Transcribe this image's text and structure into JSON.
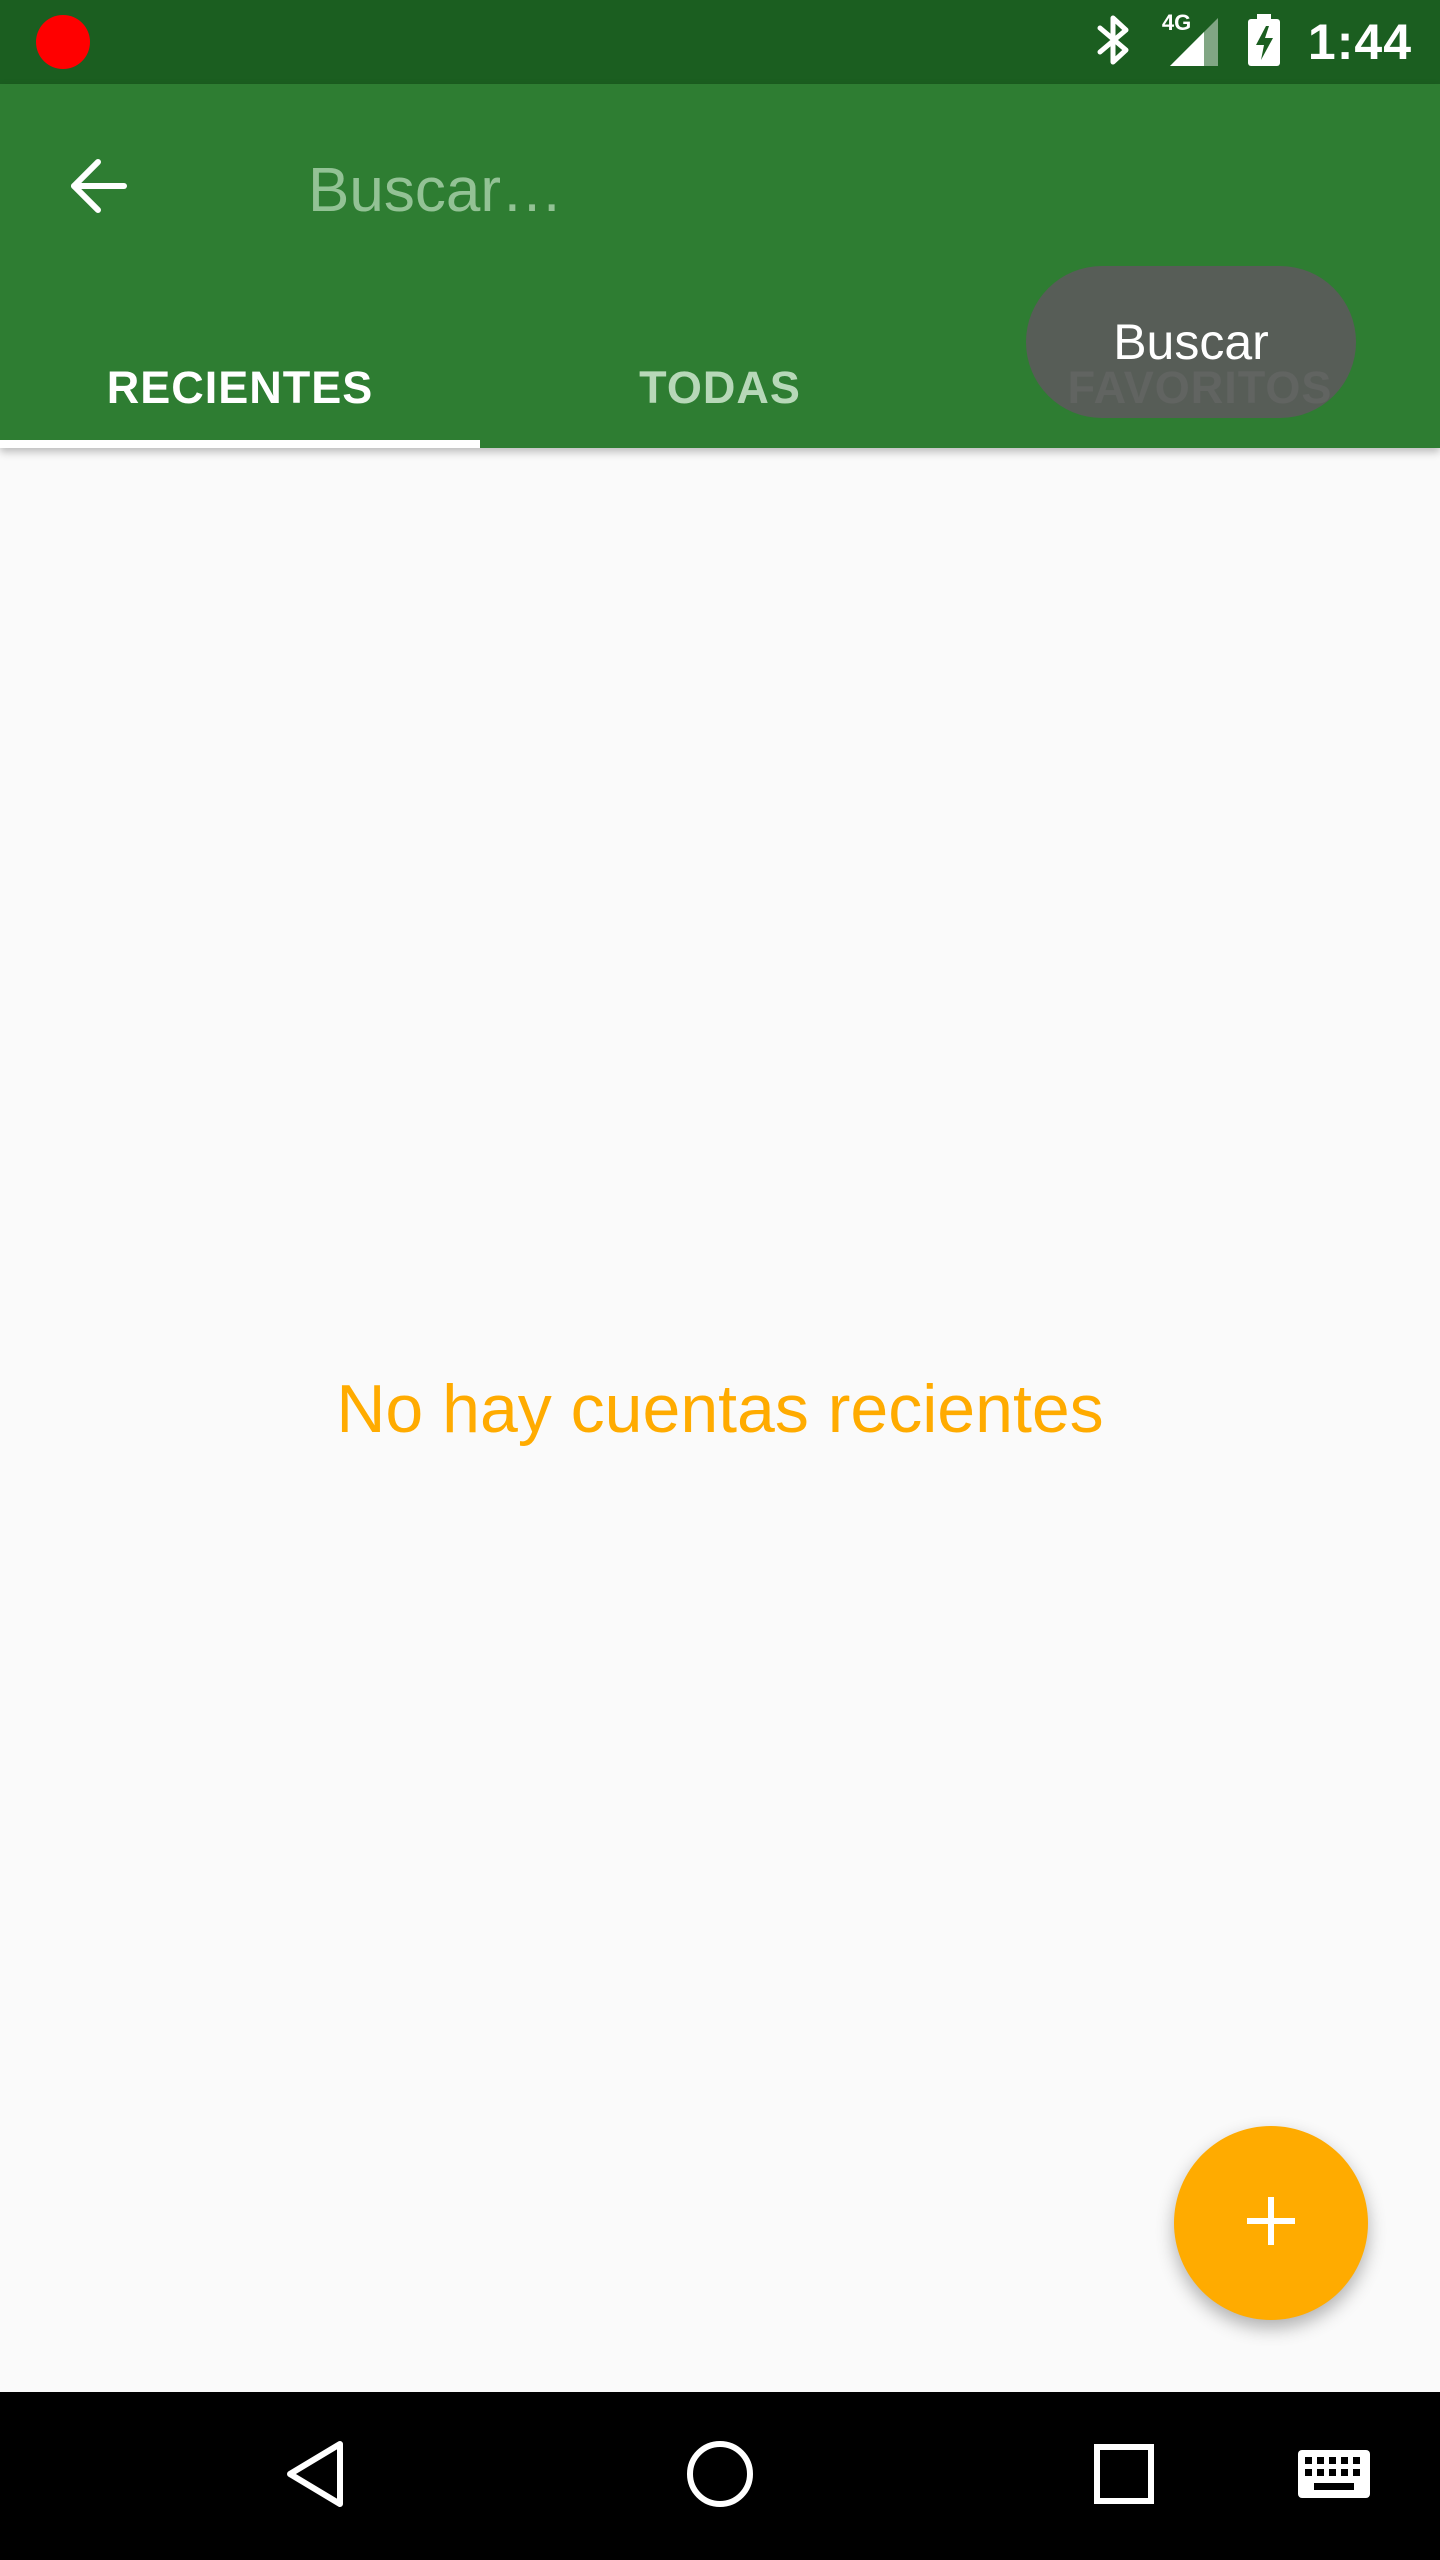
{
  "status_bar": {
    "time": "1:44",
    "network": "4G",
    "icons": [
      "record-dot-icon",
      "bluetooth-icon",
      "signal-4g-icon",
      "battery-charging-icon"
    ]
  },
  "app_bar": {
    "search": {
      "value": "",
      "placeholder": "Buscar…"
    },
    "tabs": [
      {
        "label": "RECIENTES",
        "active": true
      },
      {
        "label": "TODAS",
        "active": false
      },
      {
        "label": "FAVORITOS",
        "active": false
      }
    ]
  },
  "tooltip": {
    "text": "Buscar"
  },
  "main": {
    "empty_message": "No hay cuentas recientes"
  },
  "fab": {
    "icon": "plus-icon"
  },
  "nav_bar": {
    "buttons": [
      "back-triangle-icon",
      "home-circle-icon",
      "recents-square-icon",
      "keyboard-icon"
    ]
  },
  "colors": {
    "status_bar": "#1b5e20",
    "primary": "#2e7d32",
    "accent": "#ffab00",
    "background": "#fafafa"
  }
}
